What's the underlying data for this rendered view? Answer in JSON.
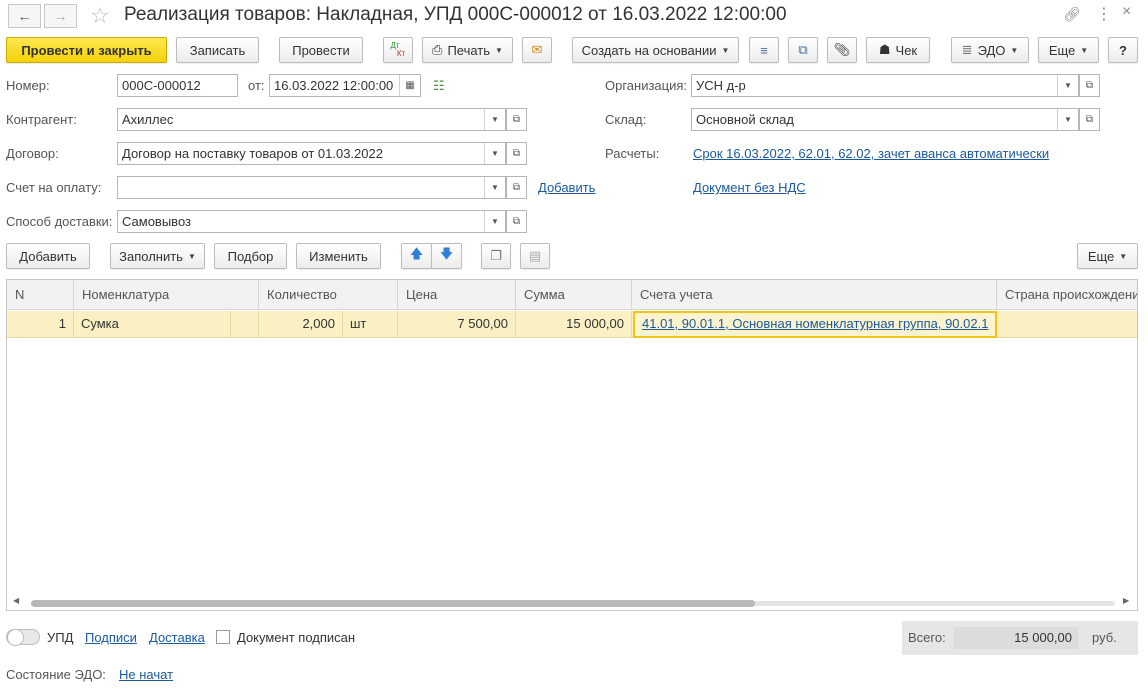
{
  "window": {
    "title": "Реализация товаров: Накладная, УПД 000С-000012 от 16.03.2022 12:00:00"
  },
  "toolbar": {
    "post_close": "Провести и закрыть",
    "save": "Записать",
    "post": "Провести",
    "dtkt_top": "Дт",
    "dtkt_bottom": "Кт",
    "print": "Печать",
    "create_based": "Создать на основании",
    "check": "Чек",
    "edo": "ЭДО",
    "more": "Еще",
    "help": "?"
  },
  "form": {
    "number_label": "Номер:",
    "number_value": "000С-000012",
    "date_label": "от:",
    "date_value": "16.03.2022 12:00:00",
    "counterparty_label": "Контрагент:",
    "counterparty_value": "Ахиллес",
    "contract_label": "Договор:",
    "contract_value": "Договор на поставку товаров от 01.03.2022",
    "invoice_label": "Счет на оплату:",
    "invoice_value": "",
    "invoice_add": "Добавить",
    "delivery_label": "Способ доставки:",
    "delivery_value": "Самовывоз",
    "org_label": "Организация:",
    "org_value": "УСН д-р",
    "warehouse_label": "Склад:",
    "warehouse_value": "Основной склад",
    "settlements_label": "Расчеты:",
    "settlements_link": "Срок 16.03.2022, 62.01, 62.02, зачет аванса автоматически",
    "vat_link": "Документ без НДС"
  },
  "table_toolbar": {
    "add": "Добавить",
    "fill": "Заполнить",
    "select": "Подбор",
    "change": "Изменить",
    "more": "Еще"
  },
  "table": {
    "columns": [
      "N",
      "Номенклатура",
      "Количество",
      "Цена",
      "Сумма",
      "Счета учета",
      "Страна происхождения"
    ],
    "rows": [
      {
        "n": "1",
        "item": "Сумка",
        "qty": "2,000",
        "unit": "шт",
        "price": "7 500,00",
        "sum": "15 000,00",
        "accounts": "41.01, 90.01.1, Основная номенклатурная группа, 90.02.1",
        "country": ""
      }
    ]
  },
  "footer": {
    "upd_label": "УПД",
    "signatures_link": "Подписи",
    "delivery_link": "Доставка",
    "signed_label": "Документ подписан",
    "total_label": "Всего:",
    "total_value": "15 000,00",
    "currency": "руб.",
    "edo_state_label": "Состояние ЭДО:",
    "edo_state_link": "Не начат"
  },
  "colors": {
    "primary_button": "#f5d20a",
    "selected_row": "#fbf0c4",
    "link": "#1a5a9e"
  }
}
